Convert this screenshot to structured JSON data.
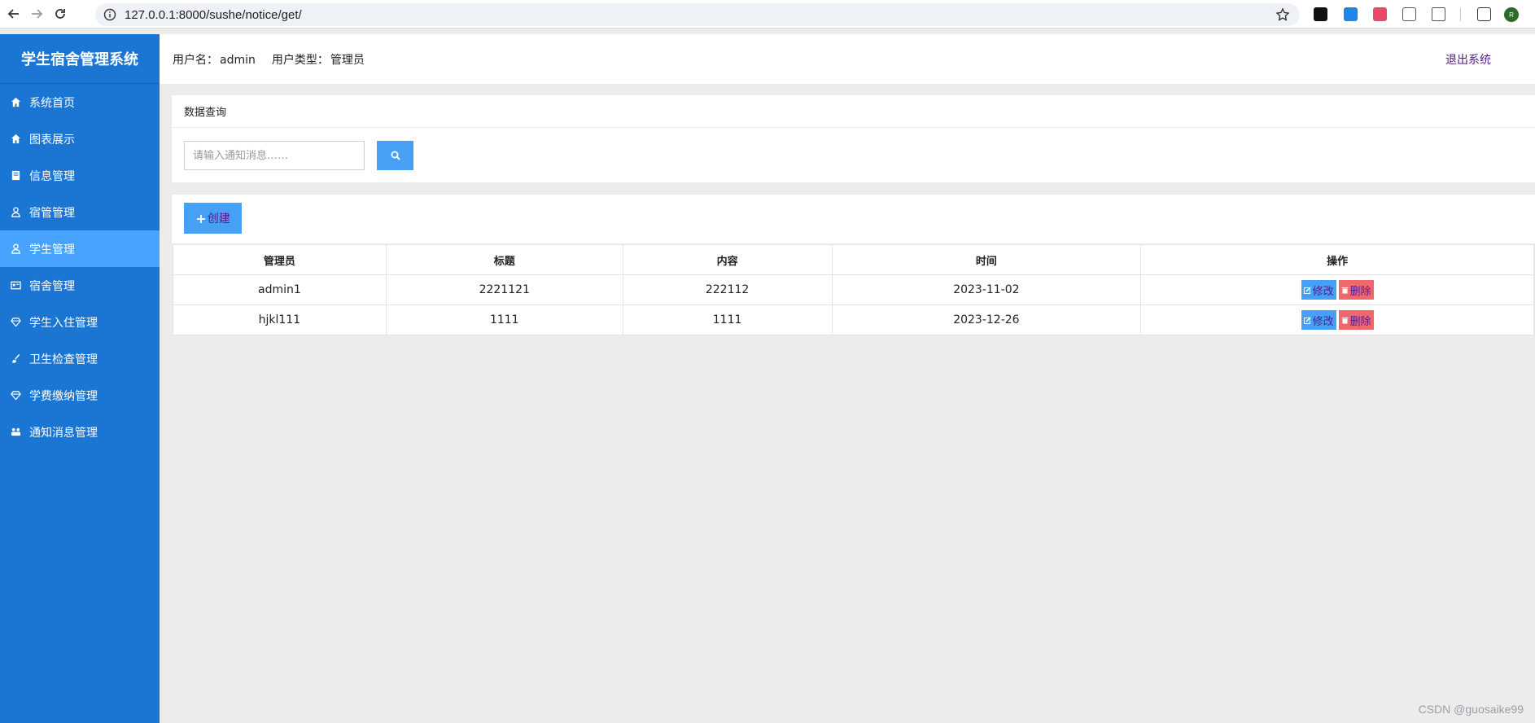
{
  "browser": {
    "url": "127.0.0.1:8000/sushe/notice/get/",
    "profile_initial": "R"
  },
  "sidebar": {
    "brand": "学生宿舍管理系统",
    "items": [
      {
        "label": "系统首页",
        "icon": "home-icon"
      },
      {
        "label": "图表展示",
        "icon": "home-icon"
      },
      {
        "label": "信息管理",
        "icon": "book-icon"
      },
      {
        "label": "宿管管理",
        "icon": "user-icon"
      },
      {
        "label": "学生管理",
        "icon": "user-icon",
        "active": true
      },
      {
        "label": "宿舍管理",
        "icon": "id-card-icon"
      },
      {
        "label": "学生入住管理",
        "icon": "diamond-icon"
      },
      {
        "label": "卫生检查管理",
        "icon": "brush-icon"
      },
      {
        "label": "学费缴纳管理",
        "icon": "diamond-icon"
      },
      {
        "label": "通知消息管理",
        "icon": "users-icon"
      }
    ]
  },
  "header": {
    "username_label": "用户名：",
    "username": "admin",
    "usertype_label": "用户类型：",
    "usertype": "管理员",
    "logout": "退出系统"
  },
  "query": {
    "title": "数据查询",
    "placeholder": "请输入通知消息……"
  },
  "list": {
    "create_label": "创建",
    "columns": [
      "管理员",
      "标题",
      "内容",
      "时间",
      "操作"
    ],
    "rows": [
      {
        "admin": "admin1",
        "title": "2221121",
        "content": "222112",
        "time": "2023-11-02",
        "edit": "修改",
        "delete": "删除"
      },
      {
        "admin": "hjkl111",
        "title": "1111",
        "content": "1111",
        "time": "2023-12-26",
        "edit": "修改",
        "delete": "删除"
      }
    ]
  },
  "watermark": "CSDN @guosaike99",
  "colors": {
    "sidebar": "#1a76d2",
    "active": "#47a3ff",
    "primary_button": "#46a0f5",
    "danger_button": "#f0686c"
  }
}
